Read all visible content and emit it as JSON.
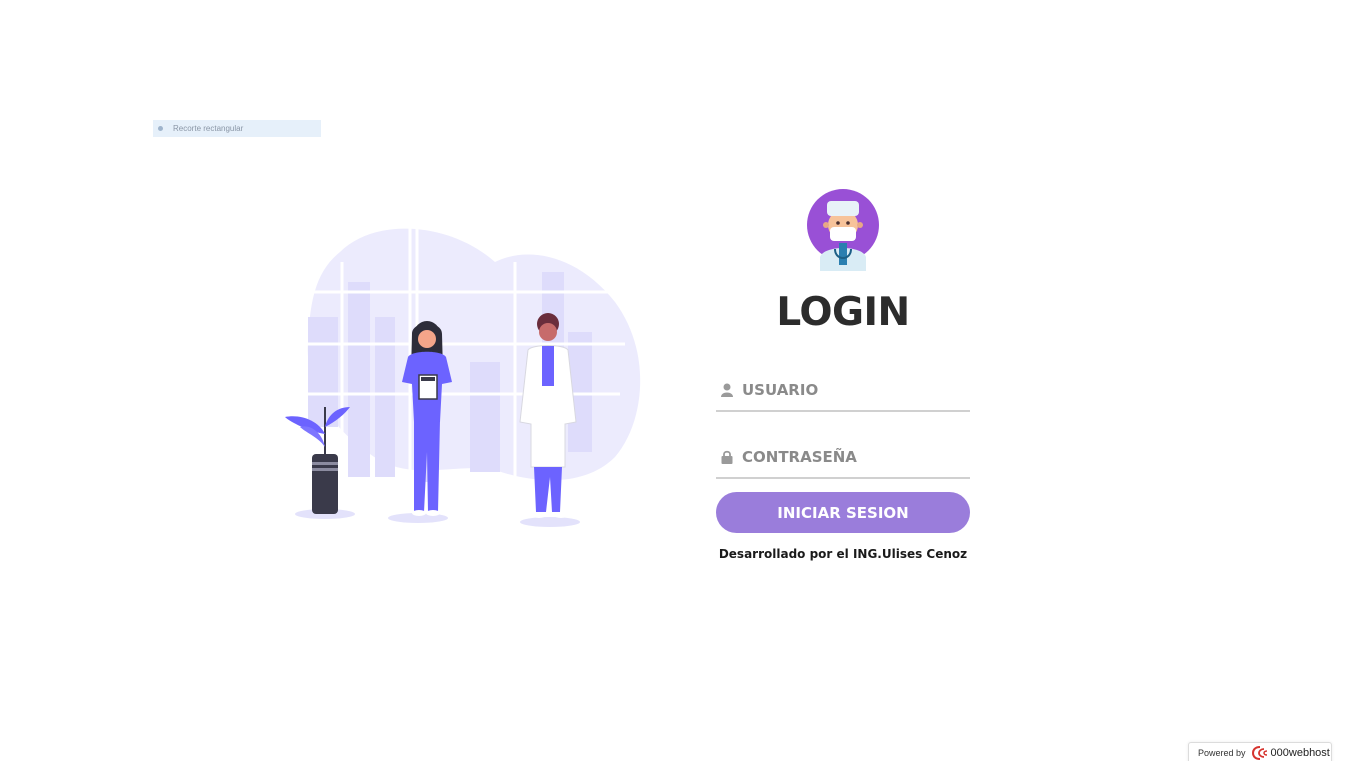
{
  "snip_strip": {
    "label": "Recorte rectangular"
  },
  "login": {
    "title": "LOGIN",
    "username_placeholder": "USUARIO",
    "password_placeholder": "CONTRASEÑA",
    "submit_label": "INICIAR SESION",
    "credit": "Desarrollado por el ING.Ulises Cenoz"
  },
  "footer": {
    "powered_by": "Powered by",
    "brand": "000webhost"
  },
  "icons": {
    "user": "user-icon",
    "lock": "lock-icon",
    "avatar": "doctor-avatar",
    "brand_logo": "000webhost-logo-icon"
  },
  "colors": {
    "accent": "#9a7ddb",
    "illustration_primary": "#6c63ff",
    "title": "#2c2c2c"
  }
}
